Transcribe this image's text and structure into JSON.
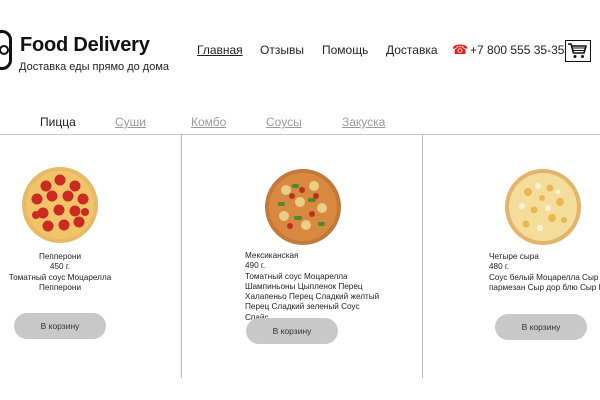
{
  "header": {
    "brand_title": "Food Delivery",
    "brand_subtitle": "Доставка еды прямо до дома",
    "nav": [
      "Главная",
      "Отзывы",
      "Помощь",
      "Доставка"
    ],
    "phone": "+7 800 555 35-35",
    "phone_icon": "phone-icon",
    "cart_icon": "shopping-cart-icon"
  },
  "tabs": [
    "Пицца",
    "Суши",
    "Комбо",
    "Соусы",
    "Закуска"
  ],
  "active_tab": "Пицца",
  "products": [
    {
      "name": "Пепперони",
      "weight": "450 г.",
      "desc1": "Томатный соус Моцарелла",
      "desc2": "Пепперони",
      "button": "В корзину"
    },
    {
      "name": "Мексиканская",
      "weight": "490 г.",
      "desc1": "Томатный соус Моцарелла",
      "desc2": "Шампиньоны Цыпленок Перец",
      "desc3": "Халапеньо Перец Сладкий желтый",
      "desc4": "Перец Сладкий зеленый Соус",
      "desc5": "Спайс",
      "button": "В корзину"
    },
    {
      "name": "Четыре сыра",
      "weight": "480 г.",
      "desc1": "Соус белый Моцарелла Сыр",
      "desc2": "пармезан Сыр дор блю Сыр Бри",
      "button": "В корзину"
    }
  ],
  "colors": {
    "accent_phone": "#dd2222",
    "button_gray": "#c8c8c8",
    "inactive_tab": "#9a9a9a"
  }
}
